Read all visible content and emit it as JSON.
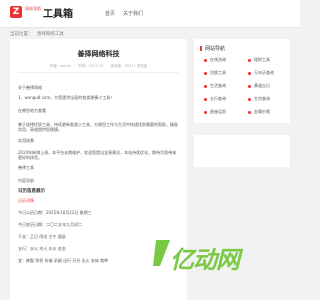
{
  "header": {
    "logo_small": "网站导航",
    "logo_big": "工具箱",
    "nav": [
      "首页",
      "关于我们"
    ]
  },
  "breadcrumb": [
    "当前位置：",
    "善择网络工具"
  ],
  "article": {
    "title": "善择网络科技",
    "meta": [
      "作者：admin",
      "时间：2025-10",
      "阅读量：28111 浏览量"
    ],
    "lines": [
      "关于善择网络",
      "1、wengu8.com，为您提供全面的各类便捷小工具！",
      "在哪些地方查看",
      "善于选择优质工具，持续更新各类小工具，方便您工作与生活中快速找到需要的帮助，精准实用，高效提供您便捷。",
      "实用场景",
      "2024年新增上线。本平台长期维护，欢迎您提出宝贵建议，本站持续优化，期待为您带来更好的体验。",
      "善择工具",
      "内容导航"
    ],
    "section_title": "日历信息展示",
    "calendar_title": "日历详情",
    "calendar_lines": [
      "今日公历日期：2025年10月22日 星期三",
      "今日农历日期：二〇二五年九月初二",
      "干支：乙巳 丙戌 壬午 庚辰",
      "五行：水火 木火 水水 金金",
      "宜：嫁娶 祭祀 祈福 求嗣 出行 开光 出火 安床 栽种"
    ]
  },
  "sidebar": {
    "heading": "网站导航",
    "items": [
      "在线咨询",
      "理财工具",
      "兑换工具",
      "万年历查询",
      "生活查询",
      "黄道吉日",
      "五行查询",
      "生肖查询",
      "星座运势",
      "金属价格"
    ]
  },
  "watermark": "亿动网"
}
